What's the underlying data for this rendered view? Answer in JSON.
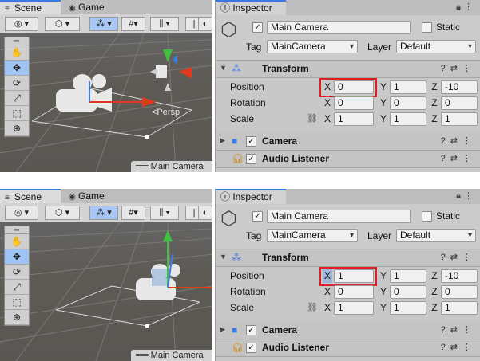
{
  "panels": [
    {
      "scene_tab": "Scene",
      "game_tab": "Game",
      "persp_label": "<Persp",
      "camera_label": "Main Camera",
      "inspector": {
        "tab_label": "Inspector",
        "name": "Main Camera",
        "static_label": "Static",
        "tag_label": "Tag",
        "tag_value": "MainCamera",
        "layer_label": "Layer",
        "layer_value": "Default",
        "transform_label": "Transform",
        "position_label": "Position",
        "rotation_label": "Rotation",
        "scale_label": "Scale",
        "position": {
          "x": "0",
          "y": "1",
          "z": "-10"
        },
        "rotation": {
          "x": "0",
          "y": "0",
          "z": "0"
        },
        "scale": {
          "x": "1",
          "y": "1",
          "z": "1"
        },
        "camera_label": "Camera",
        "audio_label": "Audio Listener"
      }
    },
    {
      "scene_tab": "Scene",
      "game_tab": "Game",
      "camera_label": "Main Camera",
      "inspector": {
        "tab_label": "Inspector",
        "name": "Main Camera",
        "static_label": "Static",
        "tag_label": "Tag",
        "tag_value": "MainCamera",
        "layer_label": "Layer",
        "layer_value": "Default",
        "transform_label": "Transform",
        "position_label": "Position",
        "rotation_label": "Rotation",
        "scale_label": "Scale",
        "position": {
          "x": "1",
          "y": "1",
          "z": "-10"
        },
        "rotation": {
          "x": "0",
          "y": "0",
          "z": "0"
        },
        "scale": {
          "x": "1",
          "y": "1",
          "z": "1"
        },
        "camera_label": "Camera",
        "audio_label": "Audio Listener"
      }
    }
  ],
  "axis_labels": {
    "x": "X",
    "y": "Y",
    "z": "Z"
  },
  "highlight_color": "#e02020",
  "icons": {
    "tools": [
      "hand-icon",
      "move-icon",
      "rotate-icon",
      "scale-icon",
      "rect-icon",
      "transform-icon"
    ],
    "components": [
      "transform-icon",
      "camera-icon",
      "audio-listener-icon"
    ]
  }
}
